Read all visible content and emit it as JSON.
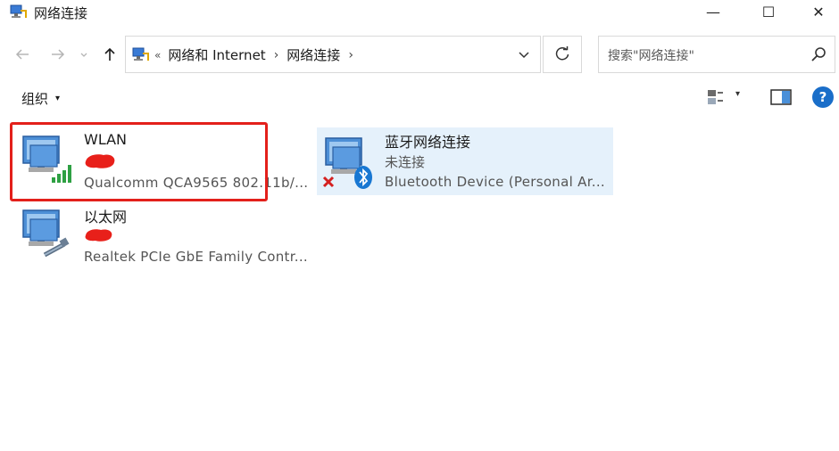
{
  "window": {
    "title": "网络连接",
    "minimize_glyph": "—",
    "maximize_glyph": "☐",
    "close_glyph": "✕"
  },
  "nav": {
    "back_icon": "arrow-left-icon",
    "forward_icon": "arrow-right-icon",
    "up_icon": "arrow-up-icon",
    "refresh_icon": "refresh-icon"
  },
  "address": {
    "overflow": "«",
    "crumbs": [
      "网络和 Internet",
      "网络连接"
    ],
    "separator": "›"
  },
  "search": {
    "placeholder": "搜索\"网络连接\""
  },
  "toolbar": {
    "organize_label": "组织",
    "organize_caret": "▾",
    "view_caret": "▾",
    "help_label": "?"
  },
  "connections": [
    {
      "name": "WLAN",
      "status": "",
      "device": "Qualcomm QCA9565 802.11b/...",
      "icon": "wireless-network-icon",
      "status_redacted": true
    },
    {
      "name": "蓝牙网络连接",
      "status": "未连接",
      "device": "Bluetooth Device (Personal Ar...",
      "icon": "bluetooth-network-icon",
      "selected": true
    },
    {
      "name": "以太网",
      "status": "",
      "device": "Realtek PCIe GbE Family Contr...",
      "icon": "ethernet-network-icon",
      "status_redacted": true
    }
  ],
  "colors": {
    "accent": "#1a6ec9",
    "selection": "#e5f1fb",
    "highlight_border": "#e3201b",
    "redaction": "#e8201a"
  }
}
